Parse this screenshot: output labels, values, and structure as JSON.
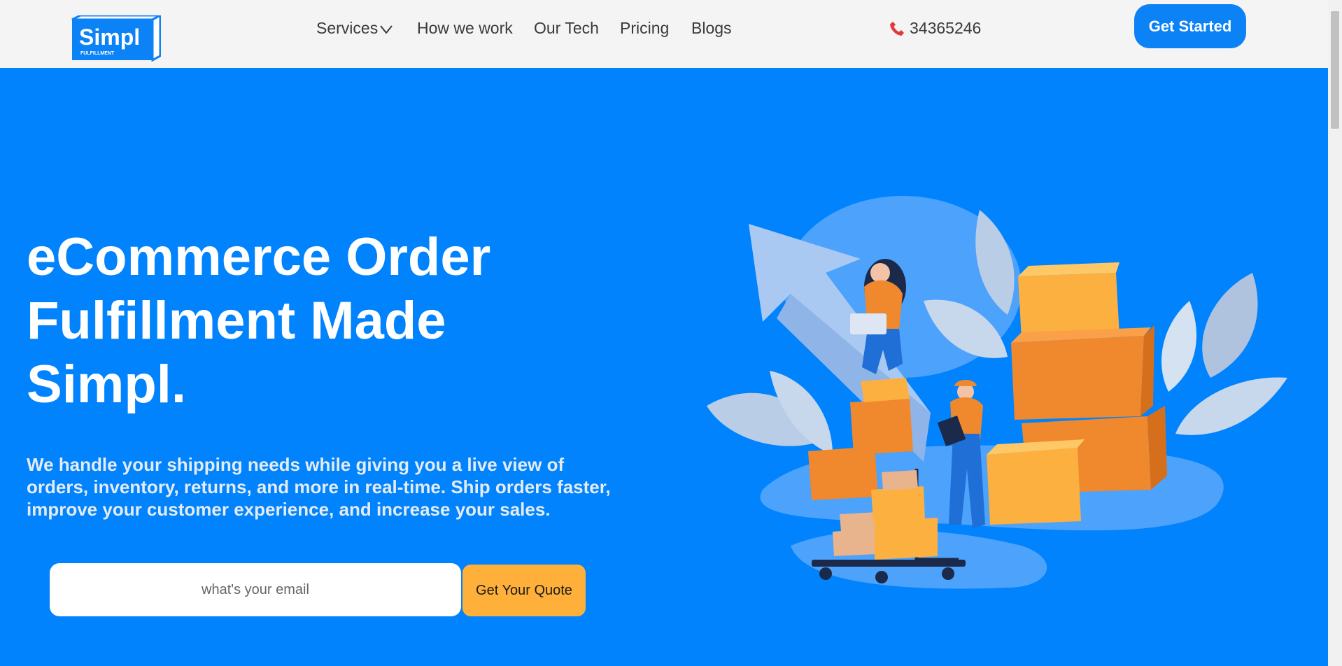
{
  "header": {
    "logo": {
      "word": "Simpl",
      "tagline": "FULFILLMENT"
    },
    "nav": [
      {
        "label": "Services",
        "has_dropdown": true
      },
      {
        "label": "How we work"
      },
      {
        "label": "Our Tech"
      },
      {
        "label": "Pricing"
      },
      {
        "label": "Blogs"
      }
    ],
    "phone": {
      "icon": "phone-icon",
      "number": "34365246"
    },
    "cta_label": "Get Started"
  },
  "hero": {
    "title_lines": [
      "eCommerce Order",
      "Fulfillment Made",
      "Simpl."
    ],
    "subtitle": "We handle your shipping needs while giving you a live view of orders, inventory, returns, and more in real-time.  Ship orders faster, improve your customer experience, and increase your sales.",
    "email": {
      "value": "",
      "placeholder": "what's your email"
    },
    "quote_label": "Get Your Quote"
  },
  "colors": {
    "hero_bg": "#0083fd",
    "header_bg": "#f4f4f4",
    "primary_button": "#0b82f6",
    "quote_button": "#ffb03a"
  }
}
